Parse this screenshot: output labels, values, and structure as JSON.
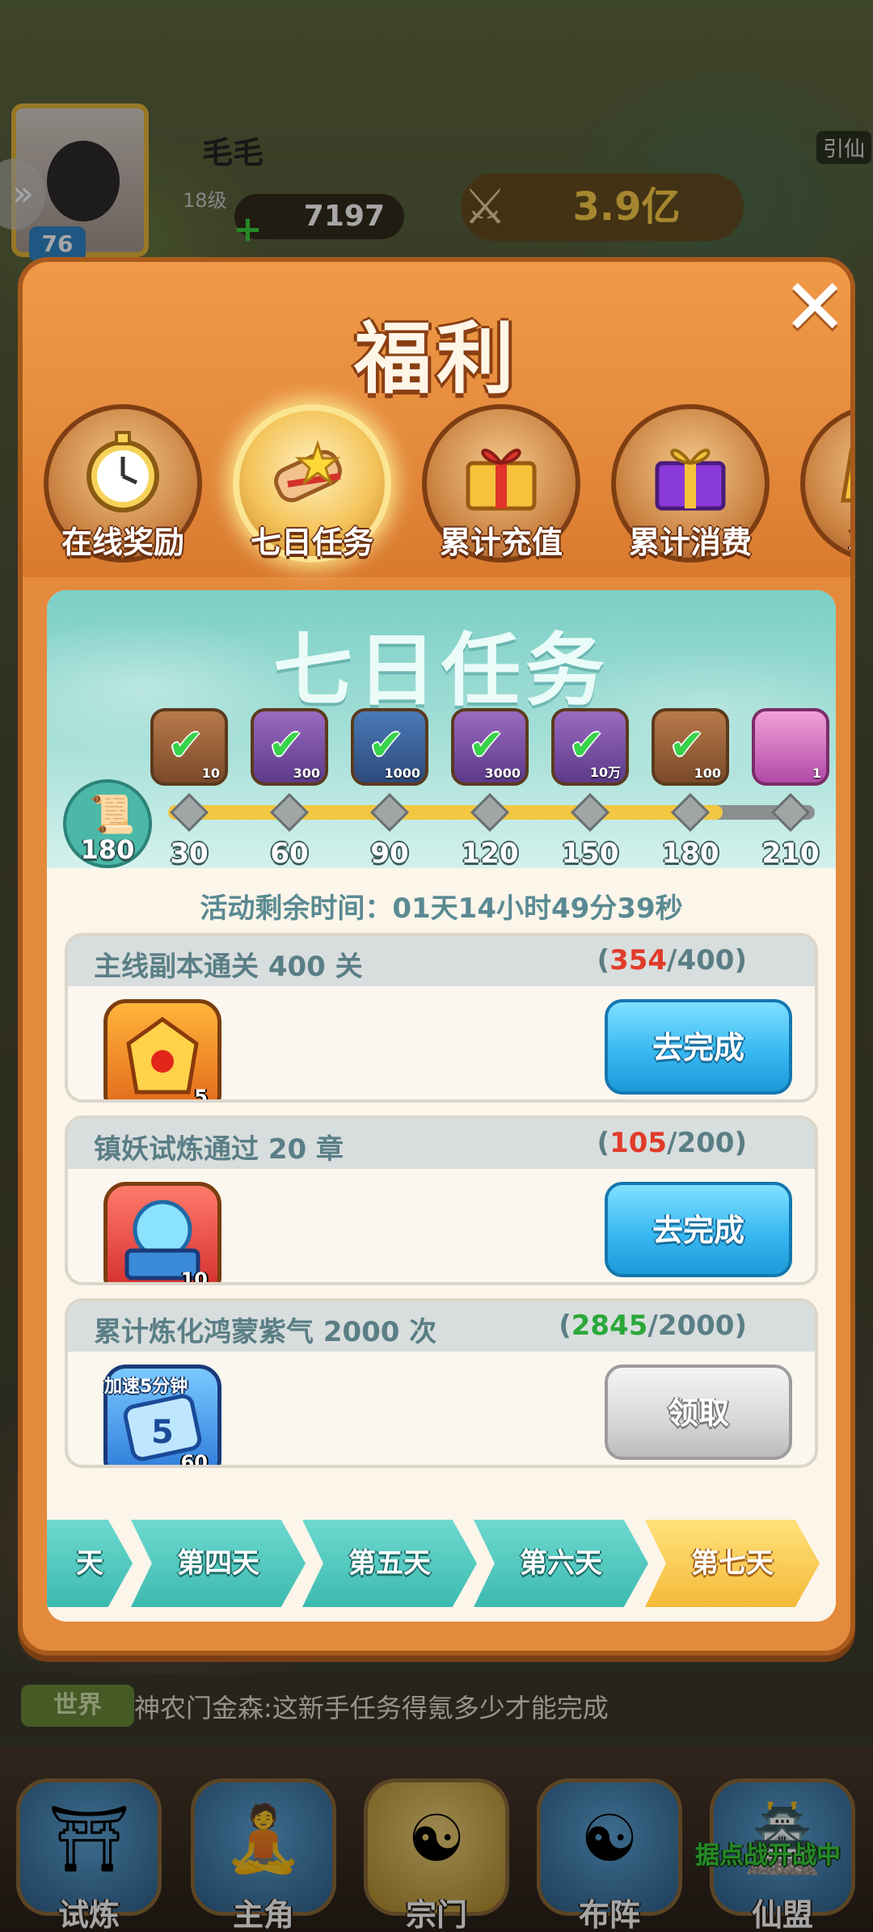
{
  "hud": {
    "player_name": "毛毛",
    "player_level": "76",
    "sub_level": "18级",
    "currency": "7197",
    "combat_power": "3.9亿",
    "right_side_label": "引仙"
  },
  "modal": {
    "title": "福利",
    "tabs": [
      {
        "label": "在线奖励",
        "icon": "stopwatch-icon",
        "active": false
      },
      {
        "label": "七日任务",
        "icon": "scroll-star-icon",
        "active": true
      },
      {
        "label": "累计充值",
        "icon": "gift-red-icon",
        "active": false
      },
      {
        "label": "累计消费",
        "icon": "gift-purple-icon",
        "active": false
      },
      {
        "label": "尊享",
        "icon": "crown-icon",
        "active": false
      }
    ]
  },
  "seven_day": {
    "title": "七日任务",
    "score": "180",
    "milestones": [
      "30",
      "60",
      "90",
      "120",
      "150",
      "180",
      "210"
    ],
    "milestone_progress": 0.857,
    "rewards": [
      {
        "count": "10",
        "claimed": true
      },
      {
        "count": "300",
        "claimed": true
      },
      {
        "count": "1000",
        "claimed": true
      },
      {
        "count": "3000",
        "claimed": true
      },
      {
        "count": "10万",
        "claimed": true
      },
      {
        "count": "100",
        "claimed": true
      },
      {
        "count": "1",
        "claimed": false
      }
    ],
    "remaining_time": "活动剩余时间：01天14小时49分39秒",
    "tasks": [
      {
        "title": "主线副本通关 400 关",
        "current": "354",
        "total": "400",
        "status": "incomplete",
        "item_count": "5",
        "item_tag": "",
        "button": "去完成"
      },
      {
        "title": "镇妖试炼通过 20 章",
        "current": "105",
        "total": "200",
        "status": "incomplete",
        "item_count": "10",
        "item_tag": "",
        "button": "去完成"
      },
      {
        "title": "累计炼化鸿蒙紫气 2000 次",
        "current": "2845",
        "total": "2000",
        "status": "complete",
        "item_count": "60",
        "item_tag": "加速5分钟",
        "button": "领取"
      }
    ],
    "days": [
      {
        "label": "天",
        "active": false
      },
      {
        "label": "第四天",
        "active": false
      },
      {
        "label": "第五天",
        "active": false
      },
      {
        "label": "第六天",
        "active": false
      },
      {
        "label": "第七天",
        "active": true
      }
    ]
  },
  "chat": {
    "channel": "世界",
    "message": "神农门金森:这新手任务得氪多少才能完成"
  },
  "nav": {
    "items": [
      {
        "label": "试炼"
      },
      {
        "label": "主角"
      },
      {
        "label": "宗门"
      },
      {
        "label": "布阵"
      },
      {
        "label": "仙盟"
      }
    ],
    "banner": "据点战开战中"
  },
  "colors": {
    "modal_bg": "#e48a3c",
    "accent_red": "#e13b2a",
    "accent_green": "#2aa83a",
    "button_blue": "#38b9f2",
    "day_teal": "#3cbab0",
    "day_active": "#f4b93a"
  }
}
